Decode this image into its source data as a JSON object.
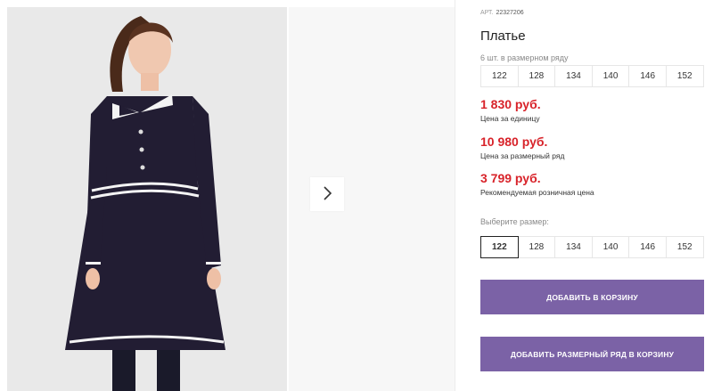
{
  "product": {
    "art_label": "АРТ.",
    "art_value": "22327206",
    "title": "Платье"
  },
  "size_row": {
    "label": "6 шт. в размерном ряду",
    "sizes": [
      "122",
      "128",
      "134",
      "140",
      "146",
      "152"
    ]
  },
  "prices": {
    "unit_price": "1 830 руб.",
    "unit_caption": "Цена за единицу",
    "row_price": "10 980 руб.",
    "row_caption": "Цена за размерный ряд",
    "retail_price": "3 799 руб.",
    "retail_caption": "Рекомендуемая розничная цена",
    "price_color": "#d8232a"
  },
  "size_select": {
    "label": "Выберите размер:",
    "sizes": [
      "122",
      "128",
      "134",
      "140",
      "146",
      "152"
    ],
    "selected": "122"
  },
  "actions": {
    "add_to_cart": "ДОБАВИТЬ В КОРЗИНУ",
    "add_row_to_cart": "ДОБАВИТЬ РАЗМЕРНЫЙ РЯД В КОРЗИНУ",
    "button_color": "#7b62a6"
  },
  "gallery": {
    "next_icon": "chevron-right-icon"
  }
}
